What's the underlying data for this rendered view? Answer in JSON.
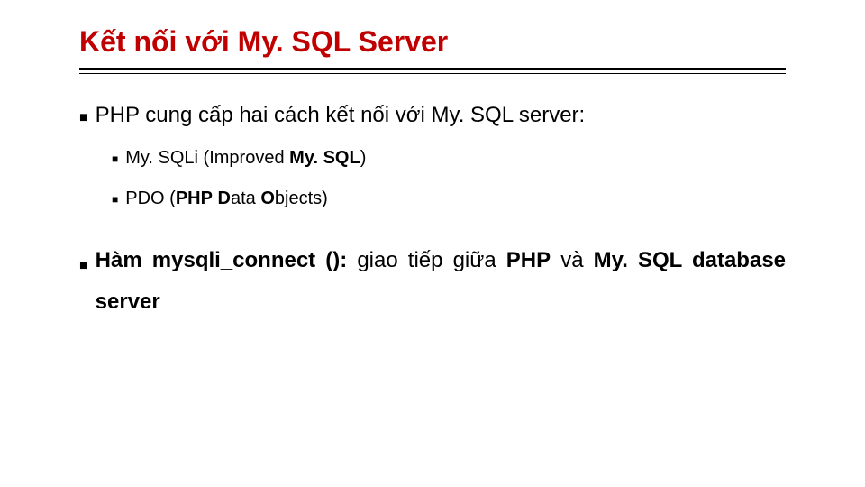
{
  "title": "Kết nối với My. SQL Server",
  "mainBullet": "PHP cung cấp hai cách kết nối với My. SQL server:",
  "sub1_a": "My. SQLi (Improved ",
  "sub1_b": "My. SQL",
  "sub1_c": ")",
  "sub2_a": "PDO (",
  "sub2_b": "PHP",
  "sub2_c": " ",
  "sub2_d": "D",
  "sub2_e": "ata ",
  "sub2_f": "O",
  "sub2_g": "bjects)",
  "last_bold1": "Hàm mysqli_connect ():",
  "last_mid": " giao tiếp giữa ",
  "last_bold2": "PHP",
  "last_mid2": " và ",
  "last_bold3": "My. SQL database server"
}
